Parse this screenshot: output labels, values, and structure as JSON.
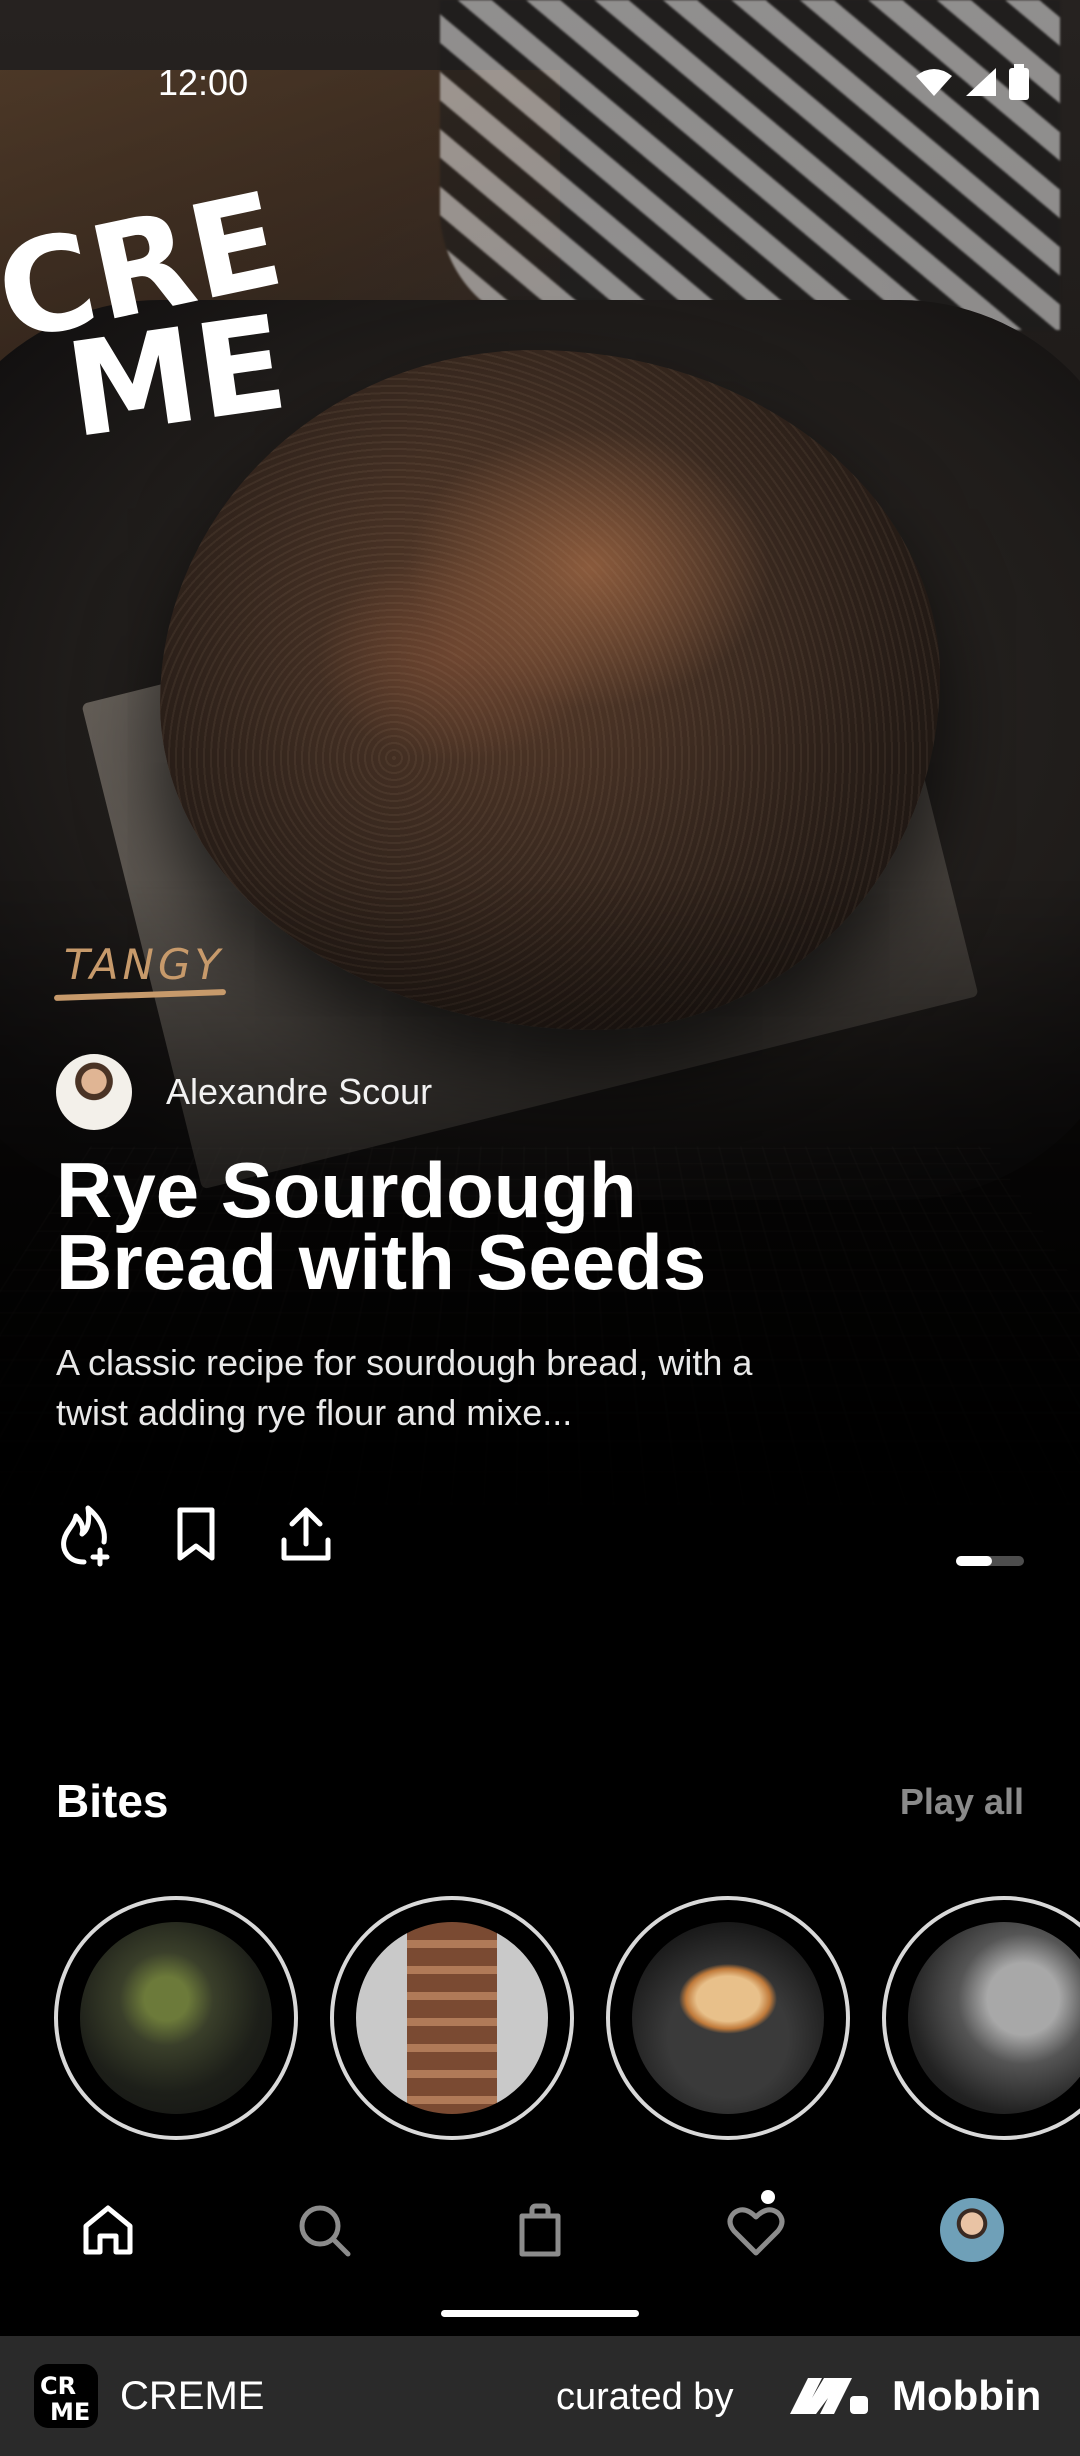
{
  "status_bar": {
    "time": "12:00"
  },
  "brand": {
    "logo_text_top": "CRE",
    "logo_text_bottom": "ME"
  },
  "hero": {
    "tag": "TANGY",
    "creator_name": "Alexandre Scour",
    "title": "Rye Sourdough Bread with Seeds",
    "description": "A classic recipe for sourdough bread, with a twist adding rye flour and mixe...",
    "actions": [
      "flame-plus-icon",
      "bookmark-icon",
      "share-icon"
    ],
    "pager": {
      "current": 1,
      "total": 2
    }
  },
  "bites": {
    "title": "Bites",
    "play_all_label": "Play all",
    "items": [
      "bite-1",
      "bite-2",
      "bite-3",
      "bite-4"
    ]
  },
  "bottom_nav": {
    "items": [
      "home-icon",
      "search-icon",
      "shopping-bag-icon",
      "heart-icon",
      "profile-avatar"
    ],
    "active": "home-icon"
  },
  "footer": {
    "app_name": "CREME",
    "curated_label": "curated by",
    "brand": "Mobbin"
  },
  "colors": {
    "accent_tag": "#c79a6b",
    "background": "#000000",
    "footer_bg": "#2a2a2a"
  }
}
